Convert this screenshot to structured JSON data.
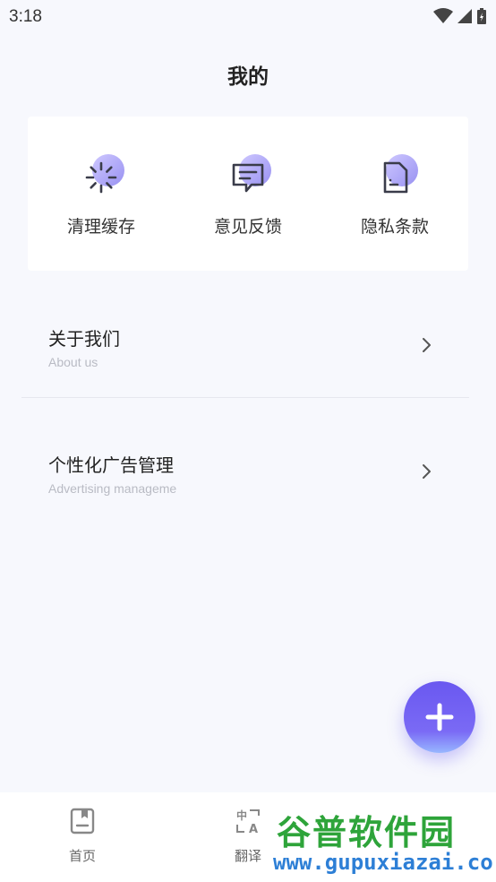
{
  "status_bar": {
    "time": "3:18"
  },
  "header": {
    "title": "我的"
  },
  "quick_actions": [
    {
      "label": "清理缓存",
      "icon": "loading-spinner-icon"
    },
    {
      "label": "意见反馈",
      "icon": "chat-feedback-icon"
    },
    {
      "label": "隐私条款",
      "icon": "document-icon"
    }
  ],
  "menu": [
    {
      "title": "关于我们",
      "subtitle": "About us"
    },
    {
      "title": "个性化广告管理",
      "subtitle": "Advertising manageme"
    }
  ],
  "bottom_nav": [
    {
      "label": "首页",
      "icon": "bookmark-page-icon"
    },
    {
      "label": "翻译",
      "icon": "translate-icon"
    }
  ],
  "watermark": {
    "title": "谷普软件园",
    "url": "www.gupuxiazai.com"
  },
  "colors": {
    "accent": "#6a58f0",
    "background": "#f7f8fd",
    "watermark_green": "#2ea43a",
    "watermark_blue": "#2d7fd6"
  }
}
